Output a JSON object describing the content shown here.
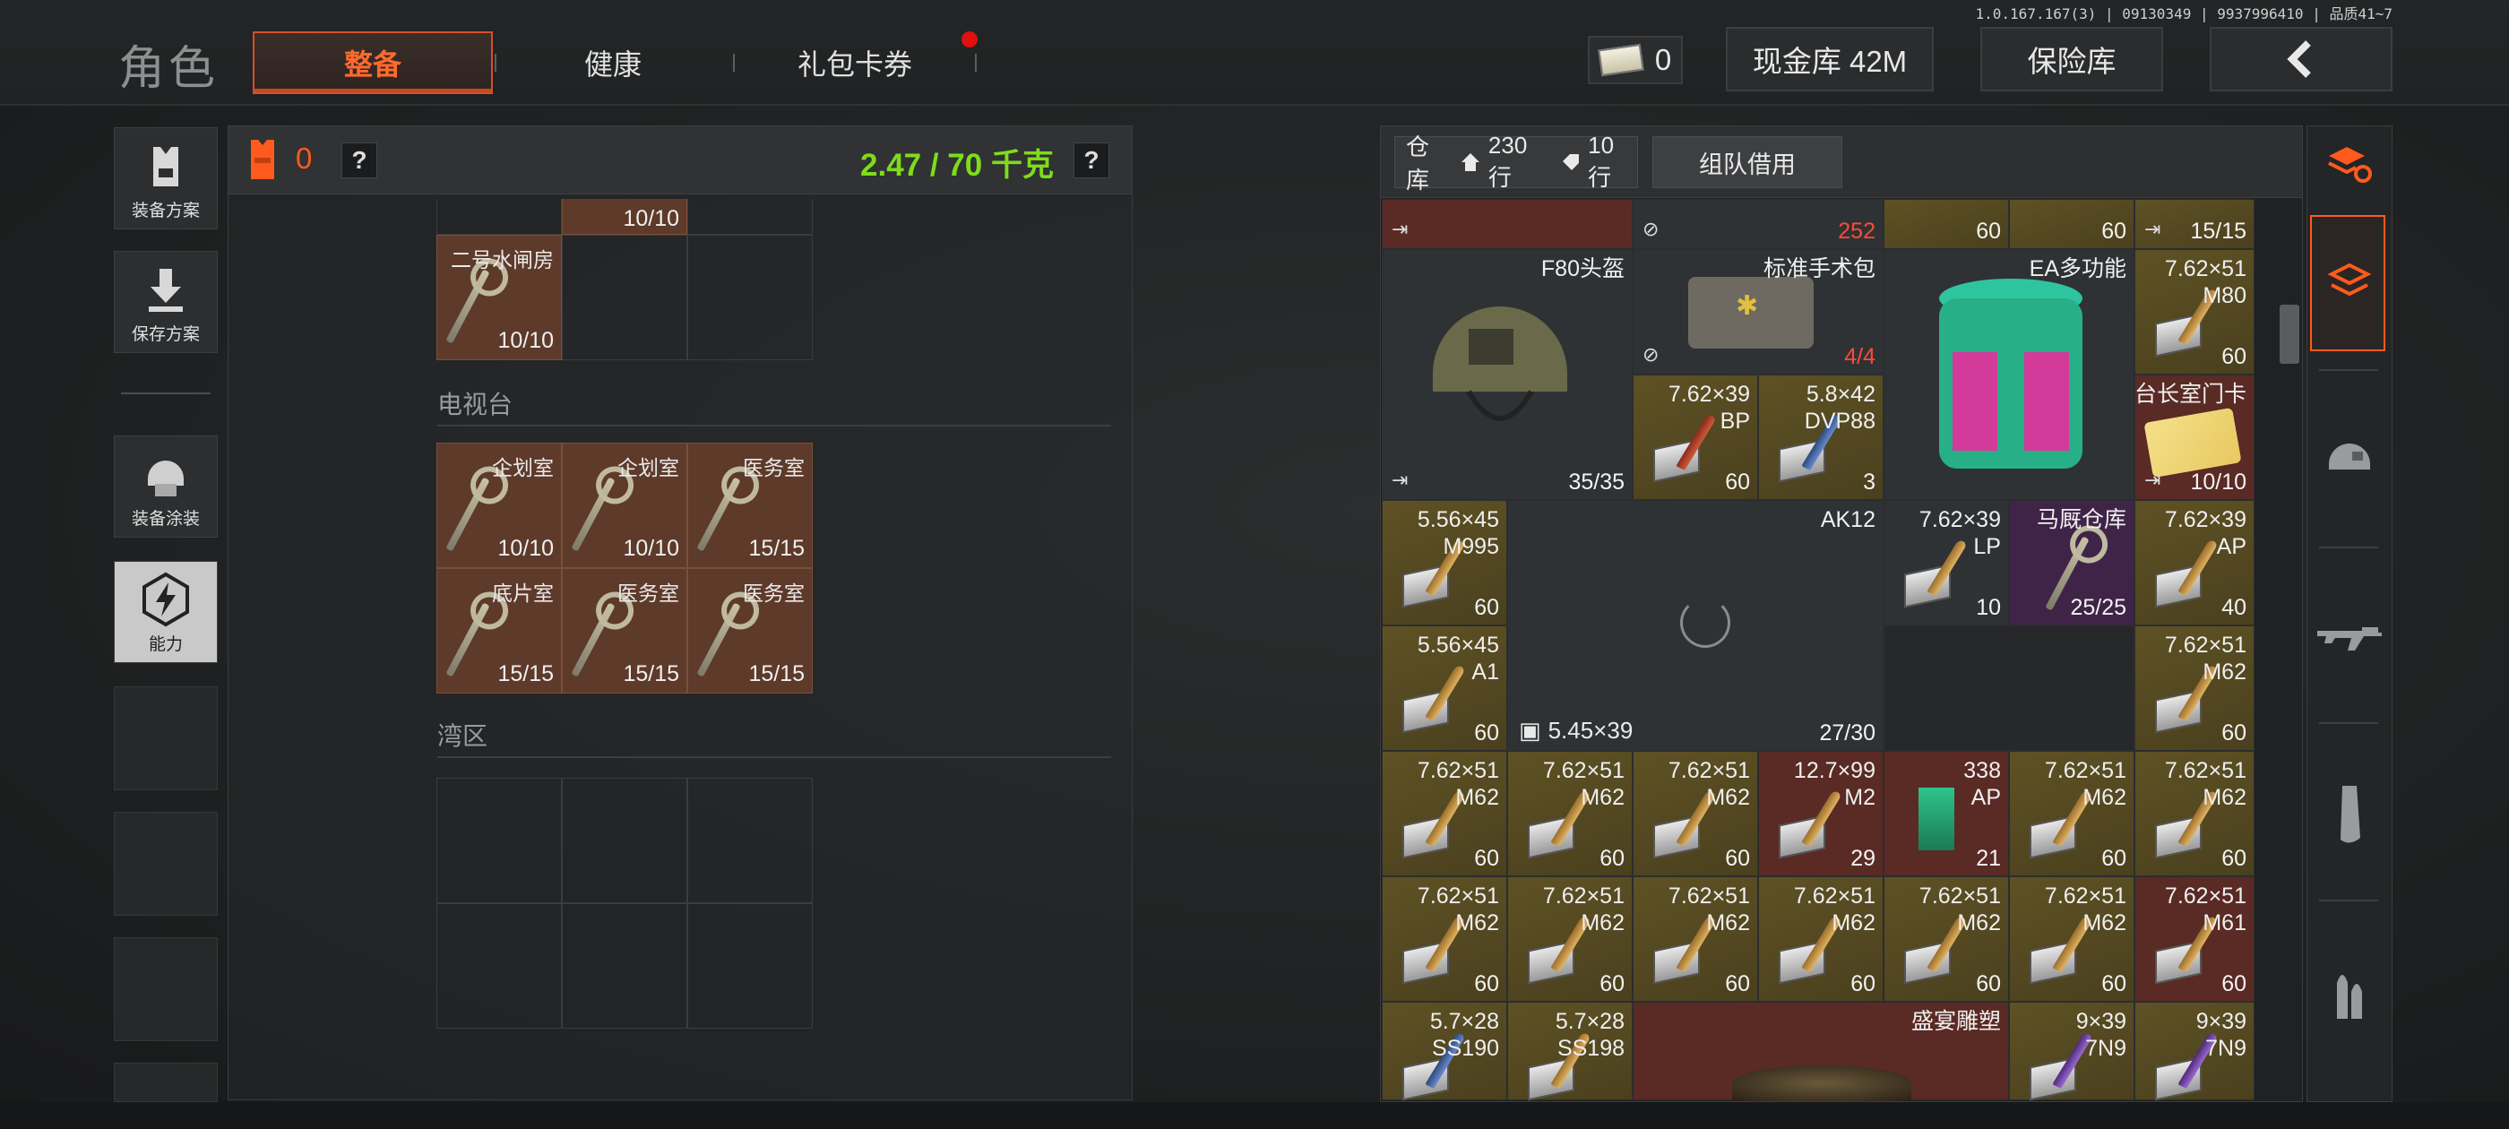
{
  "version": "1.0.167.167(3) | 09130349 | 9937996410 | 品质41~7",
  "header": {
    "title": "角色",
    "tabs": [
      "整备",
      "健康",
      "礼包卡券"
    ],
    "money_count": "0",
    "cash_vault": "现金库 42M",
    "insurance": "保险库",
    "back_icon": "back-arrow-icon"
  },
  "left_rail": {
    "gear_plan": "装备方案",
    "save_plan": "保存方案",
    "gear_paint": "装备涂装",
    "ability": "能力"
  },
  "left_panel": {
    "armor_count": "0",
    "weight": "2.47 / 70 千克",
    "help": "?",
    "top_partial_count": "10/10",
    "top_key_name": "二号水闸房",
    "top_key_count": "10/10",
    "section_tv": "电视台",
    "section_bay": "湾区",
    "tv_keys": [
      {
        "name": "企划室",
        "count": "10/10"
      },
      {
        "name": "企划室",
        "count": "10/10"
      },
      {
        "name": "医务室",
        "count": "15/15"
      },
      {
        "name": "底片室",
        "count": "15/15"
      },
      {
        "name": "医务室",
        "count": "15/15"
      },
      {
        "name": "医务室",
        "count": "15/15"
      }
    ]
  },
  "stash": {
    "label": "仓库",
    "rows": "230行",
    "tag_rows": "10行",
    "team_borrow": "组队借用",
    "items": {
      "r0": [
        {
          "count": ""
        },
        {
          "count": "252"
        },
        {
          "count": "60"
        },
        {
          "count": "60"
        },
        {
          "count": "15/15"
        }
      ],
      "helmet": {
        "name": "F80头盔",
        "count": "35/35"
      },
      "surgical": {
        "name": "标准手术包",
        "count": "4/4"
      },
      "bag": {
        "name": "EA多功能"
      },
      "m80": {
        "name": "7.62×51\nM80",
        "count": "60"
      },
      "bp": {
        "name": "7.62×39\nBP",
        "count": "60"
      },
      "dvp": {
        "name": "5.8×42\nDVP88",
        "count": "3"
      },
      "keycard": {
        "name": "台长室门卡",
        "count": "10/10"
      },
      "m995": {
        "name": "5.56×45\nM995",
        "count": "60"
      },
      "ak12": {
        "name": "AK12",
        "ammo": "5.45×39",
        "count": "27/30"
      },
      "lp": {
        "name": "7.62×39\nLP",
        "count": "10"
      },
      "stable_key": {
        "name": "马厩仓库",
        "count": "25/25"
      },
      "ap39": {
        "name": "7.62×39\nAP",
        "count": "40"
      },
      "a1": {
        "name": "5.56×45\nA1",
        "count": "60"
      },
      "m62b": {
        "name": "7.62×51\nM62",
        "count": "60"
      },
      "row_g": [
        {
          "name": "7.62×51\nM62",
          "count": "60"
        },
        {
          "name": "7.62×51\nM62",
          "count": "60"
        },
        {
          "name": "7.62×51\nM62",
          "count": "60"
        },
        {
          "name": "12.7×99\nM2",
          "count": "29"
        },
        {
          "name": "338\nAP",
          "count": "21"
        },
        {
          "name": "7.62×51\nM62",
          "count": "60"
        },
        {
          "name": "7.62×51\nM62",
          "count": "60"
        }
      ],
      "row_h": [
        {
          "name": "7.62×51\nM62",
          "count": "60"
        },
        {
          "name": "7.62×51\nM62",
          "count": "60"
        },
        {
          "name": "7.62×51\nM62",
          "count": "60"
        },
        {
          "name": "7.62×51\nM62",
          "count": "60"
        },
        {
          "name": "7.62×51\nM62",
          "count": "60"
        },
        {
          "name": "7.62×51\nM62",
          "count": "60"
        },
        {
          "name": "7.62×51\nM61",
          "count": "60"
        }
      ],
      "row_i": [
        {
          "name": "5.7×28\nSS190"
        },
        {
          "name": "5.7×28\nSS198"
        },
        {
          "name": "盛宴雕塑"
        },
        {
          "name": "9×39\n7N9"
        },
        {
          "name": "9×39\n7N9"
        }
      ]
    }
  },
  "colors": {
    "accent": "#ff6a2e",
    "weight": "#7fdc1a",
    "gold": "#5e5124",
    "red": "#5a2a24",
    "purple": "#3f2448"
  }
}
